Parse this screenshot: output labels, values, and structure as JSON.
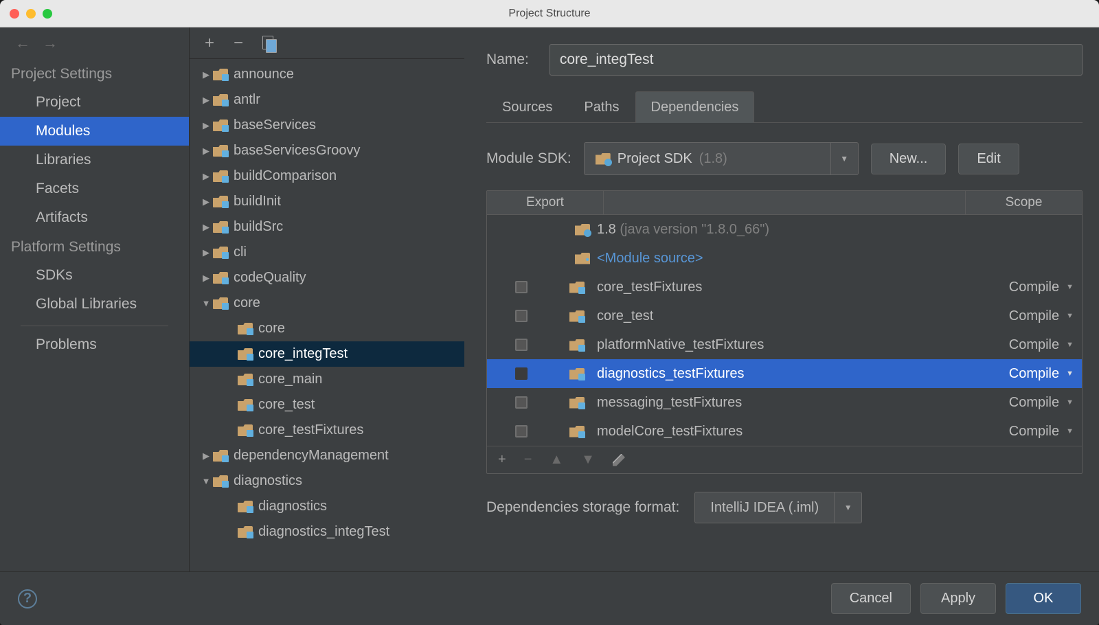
{
  "window_title": "Project Structure",
  "sidebar": {
    "sections": [
      {
        "heading": "Project Settings",
        "items": [
          "Project",
          "Modules",
          "Libraries",
          "Facets",
          "Artifacts"
        ],
        "selected": "Modules"
      },
      {
        "heading": "Platform Settings",
        "items": [
          "SDKs",
          "Global Libraries"
        ]
      }
    ],
    "problems": "Problems"
  },
  "tree": [
    {
      "label": "announce",
      "depth": 0,
      "exp": false,
      "kind": "mod"
    },
    {
      "label": "antlr",
      "depth": 0,
      "exp": false,
      "kind": "mod"
    },
    {
      "label": "baseServices",
      "depth": 0,
      "exp": false,
      "kind": "mod"
    },
    {
      "label": "baseServicesGroovy",
      "depth": 0,
      "exp": false,
      "kind": "mod"
    },
    {
      "label": "buildComparison",
      "depth": 0,
      "exp": false,
      "kind": "mod"
    },
    {
      "label": "buildInit",
      "depth": 0,
      "exp": false,
      "kind": "mod"
    },
    {
      "label": "buildSrc",
      "depth": 0,
      "exp": false,
      "kind": "mod"
    },
    {
      "label": "cli",
      "depth": 0,
      "exp": false,
      "kind": "mod"
    },
    {
      "label": "codeQuality",
      "depth": 0,
      "exp": false,
      "kind": "mod"
    },
    {
      "label": "core",
      "depth": 0,
      "exp": true,
      "kind": "mod"
    },
    {
      "label": "core",
      "depth": 1,
      "exp": null,
      "kind": "mod"
    },
    {
      "label": "core_integTest",
      "depth": 1,
      "exp": null,
      "kind": "mod",
      "selected": true
    },
    {
      "label": "core_main",
      "depth": 1,
      "exp": null,
      "kind": "mod"
    },
    {
      "label": "core_test",
      "depth": 1,
      "exp": null,
      "kind": "mod"
    },
    {
      "label": "core_testFixtures",
      "depth": 1,
      "exp": null,
      "kind": "mod"
    },
    {
      "label": "dependencyManagement",
      "depth": 0,
      "exp": false,
      "kind": "mod"
    },
    {
      "label": "diagnostics",
      "depth": 0,
      "exp": true,
      "kind": "mod"
    },
    {
      "label": "diagnostics",
      "depth": 1,
      "exp": null,
      "kind": "mod"
    },
    {
      "label": "diagnostics_integTest",
      "depth": 1,
      "exp": null,
      "kind": "mod"
    }
  ],
  "detail": {
    "name_label": "Name:",
    "name_value": "core_integTest",
    "tabs": [
      "Sources",
      "Paths",
      "Dependencies"
    ],
    "active_tab": "Dependencies",
    "sdk_label": "Module SDK:",
    "sdk_value": "Project SDK",
    "sdk_version": "(1.8)",
    "new_btn": "New...",
    "edit_btn": "Edit",
    "th_export": "Export",
    "th_scope": "Scope",
    "deps": [
      {
        "icon": "jdk",
        "name": "1.8",
        "dim": " (java version \"1.8.0_66\")",
        "checkbox": false,
        "scope": null
      },
      {
        "icon": "src",
        "name": "<Module source>",
        "link": true,
        "checkbox": false,
        "scope": null
      },
      {
        "icon": "mod",
        "name": "core_testFixtures",
        "checkbox": true,
        "scope": "Compile"
      },
      {
        "icon": "mod",
        "name": "core_test",
        "checkbox": true,
        "scope": "Compile"
      },
      {
        "icon": "mod",
        "name": "platformNative_testFixtures",
        "checkbox": true,
        "scope": "Compile"
      },
      {
        "icon": "mod",
        "name": "diagnostics_testFixtures",
        "checkbox": true,
        "scope": "Compile",
        "selected": true
      },
      {
        "icon": "mod",
        "name": "messaging_testFixtures",
        "checkbox": true,
        "scope": "Compile"
      },
      {
        "icon": "mod",
        "name": "modelCore_testFixtures",
        "checkbox": true,
        "scope": "Compile"
      }
    ],
    "storage_label": "Dependencies storage format:",
    "storage_value": "IntelliJ IDEA (.iml)"
  },
  "footer": {
    "cancel": "Cancel",
    "apply": "Apply",
    "ok": "OK"
  }
}
